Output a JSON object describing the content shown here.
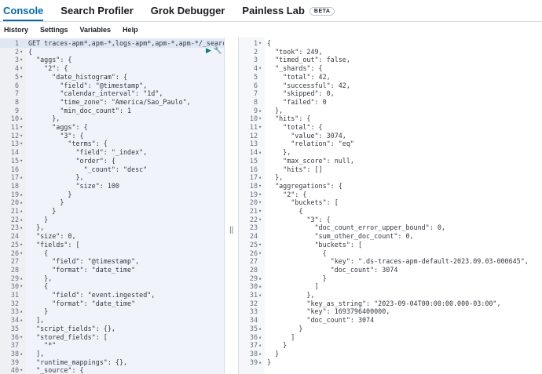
{
  "nav": {
    "tabs": [
      {
        "label": "Console"
      },
      {
        "label": "Search Profiler"
      },
      {
        "label": "Grok Debugger"
      },
      {
        "label": "Painless Lab"
      }
    ],
    "beta_label": "BETA"
  },
  "subnav": [
    "History",
    "Settings",
    "Variables",
    "Help"
  ],
  "divider_glyph": "||",
  "request": [
    {
      "n": "1",
      "t": "GET traces-apm*,apm-*,logs-apm*,apm-*,apm-*/_search"
    },
    {
      "n": "2",
      "t": "{",
      "f": "▾"
    },
    {
      "n": "3",
      "t": "  \"aggs\": {",
      "f": "▾"
    },
    {
      "n": "4",
      "t": "    \"2\": {",
      "f": "▾"
    },
    {
      "n": "5",
      "t": "      \"date_histogram\": {",
      "f": "▾"
    },
    {
      "n": "6",
      "t": "        \"field\": \"@timestamp\","
    },
    {
      "n": "7",
      "t": "        \"calendar_interval\": \"1d\","
    },
    {
      "n": "8",
      "t": "        \"time_zone\": \"America/Sao_Paulo\","
    },
    {
      "n": "9",
      "t": "        \"min_doc_count\": 1"
    },
    {
      "n": "10",
      "t": "      },",
      "f": "▴"
    },
    {
      "n": "11",
      "t": "      \"aggs\": {",
      "f": "▾"
    },
    {
      "n": "12",
      "t": "        \"3\": {",
      "f": "▾"
    },
    {
      "n": "13",
      "t": "          \"terms\": {",
      "f": "▾"
    },
    {
      "n": "14",
      "t": "            \"field\": \"_index\","
    },
    {
      "n": "15",
      "t": "            \"order\": {",
      "f": "▾"
    },
    {
      "n": "16",
      "t": "              \"_count\": \"desc\""
    },
    {
      "n": "17",
      "t": "            },",
      "f": "▴"
    },
    {
      "n": "18",
      "t": "            \"size\": 100"
    },
    {
      "n": "19",
      "t": "          }",
      "f": "▴"
    },
    {
      "n": "20",
      "t": "        }",
      "f": "▴"
    },
    {
      "n": "21",
      "t": "      }",
      "f": "▴"
    },
    {
      "n": "22",
      "t": "    }",
      "f": "▴"
    },
    {
      "n": "23",
      "t": "  },",
      "f": "▴"
    },
    {
      "n": "24",
      "t": "  \"size\": 0,"
    },
    {
      "n": "25",
      "t": "  \"fields\": [",
      "f": "▾"
    },
    {
      "n": "26",
      "t": "    {",
      "f": "▾"
    },
    {
      "n": "27",
      "t": "      \"field\": \"@timestamp\","
    },
    {
      "n": "28",
      "t": "      \"format\": \"date_time\""
    },
    {
      "n": "29",
      "t": "    },",
      "f": "▴"
    },
    {
      "n": "30",
      "t": "    {",
      "f": "▾"
    },
    {
      "n": "31",
      "t": "      \"field\": \"event.ingested\","
    },
    {
      "n": "32",
      "t": "      \"format\": \"date_time\""
    },
    {
      "n": "33",
      "t": "    }",
      "f": "▴"
    },
    {
      "n": "34",
      "t": "  ],",
      "f": "▴"
    },
    {
      "n": "35",
      "t": "  \"script_fields\": {},"
    },
    {
      "n": "36",
      "t": "  \"stored_fields\": [",
      "f": "▾"
    },
    {
      "n": "37",
      "t": "    \"*\""
    },
    {
      "n": "38",
      "t": "  ],",
      "f": "▴"
    },
    {
      "n": "39",
      "t": "  \"runtime_mappings\": {},"
    },
    {
      "n": "40",
      "t": "  \"_source\": {",
      "f": "▾"
    }
  ],
  "response": [
    {
      "n": "1",
      "t": "{",
      "f": "▾"
    },
    {
      "n": "2",
      "t": "  \"took\": 249,"
    },
    {
      "n": "3",
      "t": "  \"timed_out\": false,"
    },
    {
      "n": "4",
      "t": "  \"_shards\": {",
      "f": "▾"
    },
    {
      "n": "5",
      "t": "    \"total\": 42,"
    },
    {
      "n": "6",
      "t": "    \"successful\": 42,"
    },
    {
      "n": "7",
      "t": "    \"skipped\": 0,"
    },
    {
      "n": "8",
      "t": "    \"failed\": 0"
    },
    {
      "n": "9",
      "t": "  },",
      "f": "▴"
    },
    {
      "n": "10",
      "t": "  \"hits\": {",
      "f": "▾"
    },
    {
      "n": "11",
      "t": "    \"total\": {",
      "f": "▾"
    },
    {
      "n": "12",
      "t": "      \"value\": 3074,"
    },
    {
      "n": "13",
      "t": "      \"relation\": \"eq\""
    },
    {
      "n": "14",
      "t": "    },",
      "f": "▴"
    },
    {
      "n": "15",
      "t": "    \"max_score\": null,"
    },
    {
      "n": "16",
      "t": "    \"hits\": []"
    },
    {
      "n": "17",
      "t": "  },",
      "f": "▴"
    },
    {
      "n": "18",
      "t": "  \"aggregations\": {",
      "f": "▾"
    },
    {
      "n": "19",
      "t": "    \"2\": {",
      "f": "▾"
    },
    {
      "n": "20",
      "t": "      \"buckets\": [",
      "f": "▾"
    },
    {
      "n": "21",
      "t": "        {",
      "f": "▾"
    },
    {
      "n": "22",
      "t": "          \"3\": {",
      "f": "▾"
    },
    {
      "n": "23",
      "t": "            \"doc_count_error_upper_bound\": 0,"
    },
    {
      "n": "24",
      "t": "            \"sum_other_doc_count\": 0,"
    },
    {
      "n": "25",
      "t": "            \"buckets\": [",
      "f": "▾"
    },
    {
      "n": "26",
      "t": "              {",
      "f": "▾"
    },
    {
      "n": "27",
      "t": "                \"key\": \".ds-traces-apm-default-2023.09.03-000645\","
    },
    {
      "n": "28",
      "t": "                \"doc_count\": 3074"
    },
    {
      "n": "29",
      "t": "              }",
      "f": "▴"
    },
    {
      "n": "30",
      "t": "            ]",
      "f": "▴"
    },
    {
      "n": "31",
      "t": "          },",
      "f": "▴"
    },
    {
      "n": "32",
      "t": "          \"key_as_string\": \"2023-09-04T00:00:00.000-03:00\","
    },
    {
      "n": "33",
      "t": "          \"key\": 1693796400000,"
    },
    {
      "n": "34",
      "t": "          \"doc_count\": 3074"
    },
    {
      "n": "35",
      "t": "        }",
      "f": "▴"
    },
    {
      "n": "36",
      "t": "      ]",
      "f": "▴"
    },
    {
      "n": "37",
      "t": "    }",
      "f": "▴"
    },
    {
      "n": "38",
      "t": "  }",
      "f": "▴"
    },
    {
      "n": "39",
      "t": "}",
      "f": "▴"
    }
  ],
  "icons": {
    "play": "▶",
    "wrench": "🔧"
  }
}
